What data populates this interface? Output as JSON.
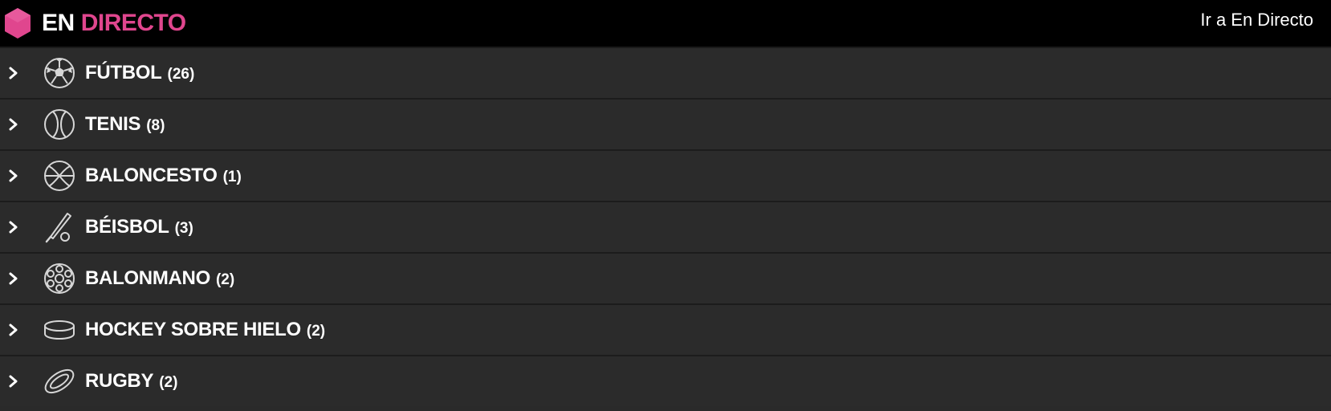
{
  "header": {
    "title_part1": "EN",
    "title_part2": "DIRECTO",
    "link_label": "Ir a En Directo",
    "accent_color": "#e0468e"
  },
  "sports": [
    {
      "name": "FÚTBOL",
      "count": "(26)",
      "icon": "soccer-ball-icon"
    },
    {
      "name": "TENIS",
      "count": "(8)",
      "icon": "tennis-ball-icon"
    },
    {
      "name": "BALONCESTO",
      "count": "(1)",
      "icon": "basketball-icon"
    },
    {
      "name": "BÉISBOL",
      "count": "(3)",
      "icon": "baseball-bat-icon"
    },
    {
      "name": "BALONMANO",
      "count": "(2)",
      "icon": "handball-icon"
    },
    {
      "name": "HOCKEY SOBRE HIELO",
      "count": "(2)",
      "icon": "hockey-puck-icon"
    },
    {
      "name": "RUGBY",
      "count": "(2)",
      "icon": "rugby-ball-icon"
    }
  ]
}
